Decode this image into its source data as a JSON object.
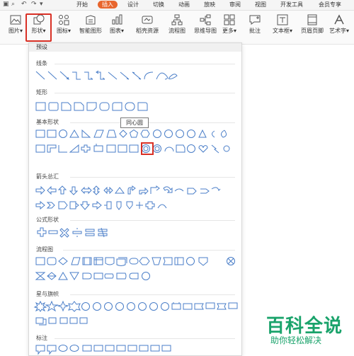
{
  "quick_access": {
    "save_icon": "save-icon",
    "search_icon": "search-icon",
    "undo_icon": "undo-icon",
    "redo_icon": "redo-icon",
    "more_icon": "dropdown-icon"
  },
  "tabs": [
    {
      "label": "开始"
    },
    {
      "label": "插入",
      "active": true
    },
    {
      "label": "设计"
    },
    {
      "label": "切换"
    },
    {
      "label": "动画"
    },
    {
      "label": "放映"
    },
    {
      "label": "审阅"
    },
    {
      "label": "视图"
    },
    {
      "label": "开发工具"
    },
    {
      "label": "会员专享"
    }
  ],
  "ribbon": {
    "picture": "图片▾",
    "shape": "形状▾",
    "icon": "图标▾",
    "smart_graphic": "智能图形",
    "chart": "图表▾",
    "daoke": "稻壳资源",
    "flowchart": "流程图",
    "mindmap": "思维导图",
    "more": "更多▾",
    "comment": "批注",
    "textbox": "文本框▾",
    "header_footer": "页眉页脚",
    "art_text": "艺术字▾"
  },
  "dropdown": {
    "presets_label": "预设",
    "categories": {
      "lines": "线条",
      "rect": "矩形",
      "basic": "基本形状",
      "arrows": "箭头总汇",
      "formula": "公式形状",
      "flow": "流程图",
      "stars": "星与旗帜",
      "callouts": "标注"
    },
    "tooltip": "同心圆"
  },
  "colors": {
    "accent": "#e8652d",
    "highlight": "#d93025",
    "shape_stroke": "#4a7ec8",
    "watermark": "#1aa36b"
  },
  "watermark": {
    "main": "百科全说",
    "sub": "助你轻松解决"
  }
}
